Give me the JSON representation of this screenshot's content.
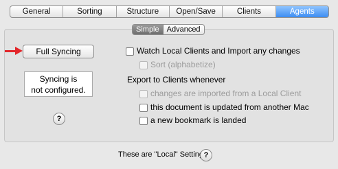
{
  "tabs": [
    "General",
    "Sorting",
    "Structure",
    "Open/Save",
    "Clients",
    "Agents"
  ],
  "active_tab": "Agents",
  "segments": [
    "Simple",
    "Advanced"
  ],
  "active_segment": "Simple",
  "sync_button_label": "Full Syncing",
  "status_line1": "Syncing is",
  "status_line2": "not configured.",
  "help_icon": "?",
  "options": {
    "watch_label": "Watch Local Clients and Import any changes",
    "sort_label": "Sort (alphabetize)",
    "export_heading": "Export to Clients whenever",
    "changes_label": "changes are imported from a Local Client",
    "document_label": "this document is updated from another Mac",
    "bookmark_label": "a new bookmark is landed"
  },
  "footer_text": "These are \"Local\" Settings",
  "colors": {
    "accent": "#3d8df2",
    "arrow": "#e3262a"
  }
}
